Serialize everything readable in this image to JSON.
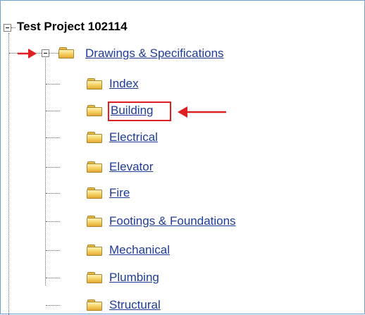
{
  "tree": {
    "root": {
      "label": "Test Project 102114",
      "expanded": true
    },
    "folder": {
      "label": "Drawings & Specifications",
      "expanded": true,
      "children": [
        {
          "label": "Index"
        },
        {
          "label": "Building",
          "highlighted": true
        },
        {
          "label": "Electrical"
        },
        {
          "label": "Elevator"
        },
        {
          "label": "Fire"
        },
        {
          "label": "Footings & Foundations"
        },
        {
          "label": "Mechanical"
        },
        {
          "label": "Plumbing"
        },
        {
          "label": "Structural"
        }
      ]
    }
  },
  "annotations": {
    "arrow_color": "#e02020",
    "link_color": "#1f3c98",
    "folder_color": "#f5cf5c"
  }
}
